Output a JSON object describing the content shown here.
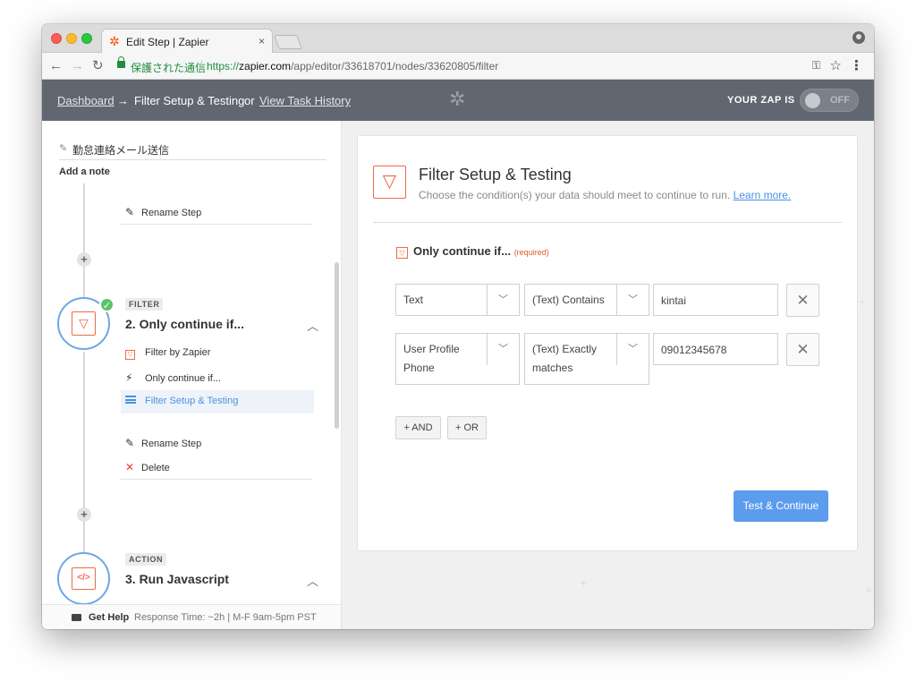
{
  "browser": {
    "tab_title": "Edit Step | Zapier",
    "tab_close": "×",
    "secure_label": "保護された通信",
    "url_scheme": "https://",
    "url_host": "zapier.com",
    "url_path": "/app/editor/33618701/nodes/33620805/filter"
  },
  "header": {
    "dashboard": "Dashboard",
    "arrow": "→",
    "current": "Filter Setup & Testing",
    "or": "or",
    "history": "View Task History",
    "zap_label": "YOUR ZAP IS",
    "toggle_state": "OFF"
  },
  "sidebar": {
    "step_name": "勤怠連絡メール送信",
    "add_note": "Add a note",
    "rename_top": "Rename Step",
    "filter_step": {
      "tag": "FILTER",
      "title": "2. Only continue if...",
      "sub_app": "Filter by Zapier",
      "sub_trigger": "Only continue if...",
      "sub_setup": "Filter Setup & Testing",
      "rename": "Rename Step",
      "delete": "Delete"
    },
    "action_step": {
      "tag": "ACTION",
      "title": "3. Run Javascript",
      "icon_text": "</>"
    },
    "help": {
      "title": "Get Help",
      "sub": "Response Time: ~2h | M-F 9am-5pm PST"
    }
  },
  "card": {
    "title": "Filter Setup & Testing",
    "subtitle": "Choose the condition(s) your data should meet to continue to run.",
    "learn_more": "Learn more.",
    "section_title": "Only continue if...",
    "required": "(required)",
    "rows": [
      {
        "field": "Text",
        "operator": "(Text) Contains",
        "value": "kintai"
      },
      {
        "field": "User Profile Phone",
        "operator": "(Text) Exactly matches",
        "value": "09012345678"
      }
    ],
    "and_btn": "+ AND",
    "or_btn": "+ OR",
    "test_btn": "Test & Continue"
  },
  "colors": {
    "header_bg": "#606770",
    "accent_orange": "#ef6a47",
    "primary_blue": "#5c9cec",
    "active_blue": "#4a90e2",
    "check_green": "#5ec26a"
  }
}
